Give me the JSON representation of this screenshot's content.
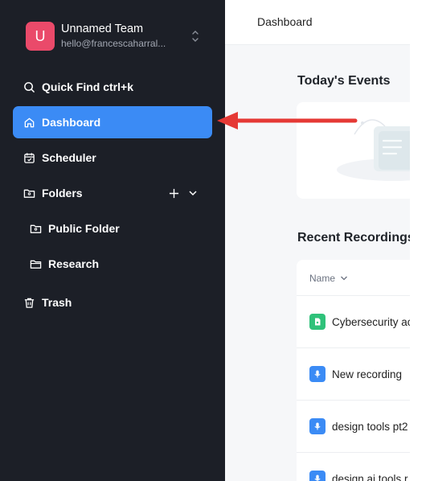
{
  "team": {
    "avatar_letter": "U",
    "name": "Unnamed Team",
    "email": "hello@francescaharral..."
  },
  "nav": {
    "quick_find": "Quick Find ctrl+k",
    "dashboard": "Dashboard",
    "scheduler": "Scheduler",
    "folders": "Folders",
    "public_folder": "Public Folder",
    "research": "Research",
    "trash": "Trash"
  },
  "main": {
    "page_title": "Dashboard",
    "events_title": "Today's Events",
    "recordings_title": "Recent Recordings",
    "column_name": "Name",
    "recordings": [
      {
        "name": "Cybersecurity ac",
        "icon": "document-icon",
        "color": "#2fc27a"
      },
      {
        "name": "New recording",
        "icon": "microphone-icon",
        "color": "#3b8bf5"
      },
      {
        "name": "design tools pt2",
        "icon": "microphone-icon",
        "color": "#3b8bf5"
      },
      {
        "name": "design ai tools r",
        "icon": "microphone-icon",
        "color": "#3b8bf5"
      }
    ]
  },
  "colors": {
    "sidebar_bg": "#1c1f27",
    "accent": "#3b8bf5",
    "avatar": "#ea4a6a",
    "annotation_arrow": "#e53935"
  }
}
